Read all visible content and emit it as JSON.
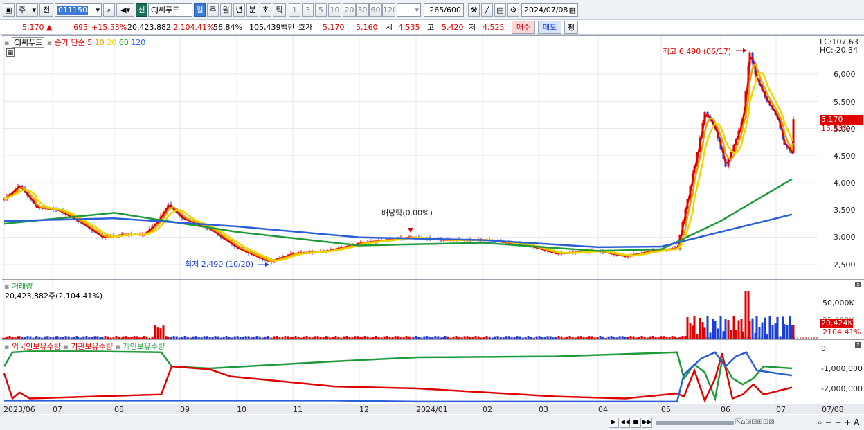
{
  "toolbar": {
    "market_dropdown": "주",
    "prev_btn": "전",
    "stock_code": "011150",
    "new_badge": "신",
    "stock_name": "CJ씨푸드",
    "period_tabs": [
      "일",
      "주",
      "월",
      "년",
      "분",
      "초",
      "틱"
    ],
    "active_period": "일",
    "interval_buttons": [
      "1",
      "3",
      "5",
      "10",
      "20",
      "30",
      "60",
      "120"
    ],
    "count_value": "265",
    "count_max": "/600",
    "date": "2024/07/08"
  },
  "quote": {
    "price": "5,170",
    "change_arrow": "▲",
    "change": "695",
    "change_pct": "+15.53%",
    "volume": "20,423,882",
    "volume_ratio": "2,104.41%",
    "turnover_pct": "56.84%",
    "amount": "105,439백만",
    "hoga_label": "호가",
    "hoga_ask": "5,170",
    "hoga_bid": "5,160",
    "open_label": "시",
    "open": "4,535",
    "high_label": "고",
    "high": "5,420",
    "low_label": "저",
    "low": "4,525",
    "buy_btn": "매수",
    "sell_btn": "매도",
    "eval_btn": "평"
  },
  "price_pane": {
    "name_tag": "CJ씨푸드",
    "legend_title": "종가 단순",
    "ma_labels": [
      "5",
      "10",
      "20",
      "60",
      "120"
    ],
    "ma_colors": [
      "#e00000",
      "#f0a000",
      "#e8d800",
      "#1f9a3a",
      "#2a5fd8"
    ],
    "lc_label": "LC:107.63",
    "hc_label": "HC:-20.34",
    "y_ticks": [
      "6,000",
      "5,500",
      "5,000",
      "4,500",
      "4,000",
      "3,500",
      "3,000",
      "2,500"
    ],
    "current_price_tag": "5,170",
    "current_pct_tag": "15.53%",
    "high_annotation": "최고 6,490 (06/17)",
    "low_annotation": "최저 2,490 (10/20)",
    "dividend_annotation": "배당락(0.00%)"
  },
  "volume_pane": {
    "title": "거래량",
    "subtitle": "20,423,882주(2,104.41%)",
    "y_ticks": [
      "50,000K",
      "25,000K"
    ],
    "current_tag": "20,424K",
    "current_pct": "2104.41%"
  },
  "holding_pane": {
    "legends": [
      "외국인보유수량",
      "기관보유수량",
      "개인보유수량"
    ],
    "legend_colors": [
      "#e00000",
      "#2a5fd8",
      "#1f9a3a"
    ],
    "y_ticks": [
      "0",
      "-1,000,000",
      "-2,000,000"
    ]
  },
  "x_axis": {
    "labels": [
      "2023/06",
      "07",
      "08",
      "09",
      "10",
      "11",
      "12",
      "2024/01",
      "02",
      "03",
      "04",
      "05",
      "06",
      "07"
    ],
    "right_label": "07/08"
  },
  "chart_data": {
    "type": "line",
    "title": "CJ씨푸드",
    "ylabel": "",
    "ylim": [
      2400,
      6600
    ],
    "series": [
      {
        "name": "종가",
        "x": [
          "2023/06",
          "2023/07",
          "2023/08",
          "2023/09",
          "2023/10",
          "2023/11",
          "2023/12",
          "2024/01",
          "2024/02",
          "2024/03",
          "2024/04",
          "2024/05",
          "2024/06",
          "2024/07/08"
        ],
        "values": [
          3700,
          3350,
          3050,
          3550,
          2700,
          2750,
          2950,
          3050,
          2950,
          2800,
          2700,
          3000,
          5800,
          5170
        ]
      },
      {
        "name": "60",
        "x": [
          "2023/06",
          "2023/08",
          "2023/10",
          "2023/12",
          "2024/02",
          "2024/04",
          "2024/05",
          "2024/06",
          "2024/07/08"
        ],
        "values": [
          3250,
          3450,
          3100,
          2850,
          2900,
          2750,
          2780,
          3300,
          4070
        ]
      },
      {
        "name": "120",
        "x": [
          "2023/06",
          "2023/08",
          "2023/10",
          "2023/12",
          "2024/02",
          "2024/04",
          "2024/05",
          "2024/06",
          "2024/07/08"
        ],
        "values": [
          3300,
          3350,
          3200,
          3000,
          2950,
          2820,
          2830,
          3100,
          3420
        ]
      }
    ],
    "annotations": [
      "최고 6,490 (06/17)",
      "최저 2,490 (10/20)",
      "배당락(0.00%)"
    ]
  }
}
